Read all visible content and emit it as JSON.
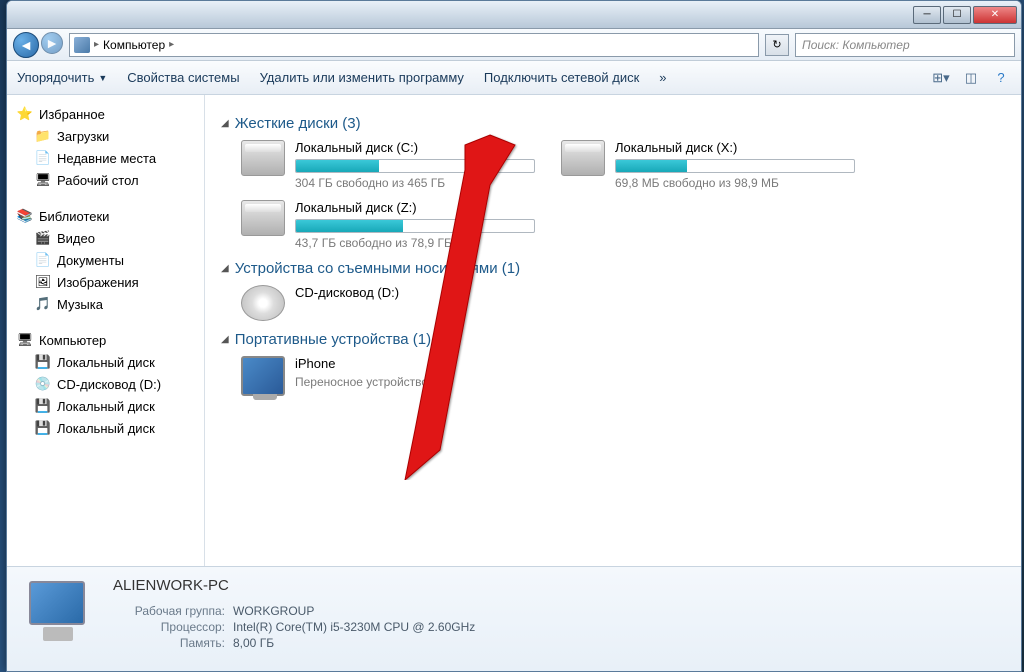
{
  "titlebar": {
    "min": "─",
    "max": "☐",
    "close": "✕"
  },
  "address": {
    "location": "Компьютер",
    "search_placeholder": "Поиск: Компьютер",
    "chevron": "▸",
    "refresh": "↻"
  },
  "nav": {
    "back": "◄",
    "fwd": "►"
  },
  "toolbar": {
    "organize": "Упорядочить",
    "system_props": "Свойства системы",
    "uninstall": "Удалить или изменить программу",
    "map_drive": "Подключить сетевой диск",
    "more": "»"
  },
  "sidebar": {
    "favorites": "Избранное",
    "downloads": "Загрузки",
    "recent": "Недавние места",
    "desktop": "Рабочий стол",
    "libraries": "Библиотеки",
    "video": "Видео",
    "documents": "Документы",
    "pictures": "Изображения",
    "music": "Музыка",
    "computer": "Компьютер",
    "local_disk": "Локальный диск",
    "cd_drive": "CD-дисковод (D:)"
  },
  "sections": {
    "hdd": "Жесткие диски (3)",
    "removable": "Устройства со съемными носителями (1)",
    "portable": "Портативные устройства (1)"
  },
  "drives": {
    "c": {
      "name": "Локальный диск (C:)",
      "free": "304 ГБ свободно из 465 ГБ",
      "pct": 35
    },
    "x": {
      "name": "Локальный диск (X:)",
      "free": "69,8 МБ свободно из 98,9 МБ",
      "pct": 30
    },
    "z": {
      "name": "Локальный диск (Z:)",
      "free": "43,7 ГБ свободно из 78,9 ГБ",
      "pct": 45
    },
    "cd": {
      "name": "CD-дисковод (D:)"
    },
    "iphone": {
      "name": "iPhone",
      "desc": "Переносное устройство"
    }
  },
  "details": {
    "name": "ALIENWORK-PC",
    "workgroup_lbl": "Рабочая группа:",
    "workgroup": "WORKGROUP",
    "cpu_lbl": "Процессор:",
    "cpu": "Intel(R) Core(TM) i5-3230M CPU @ 2.60GHz",
    "ram_lbl": "Память:",
    "ram": "8,00 ГБ"
  }
}
